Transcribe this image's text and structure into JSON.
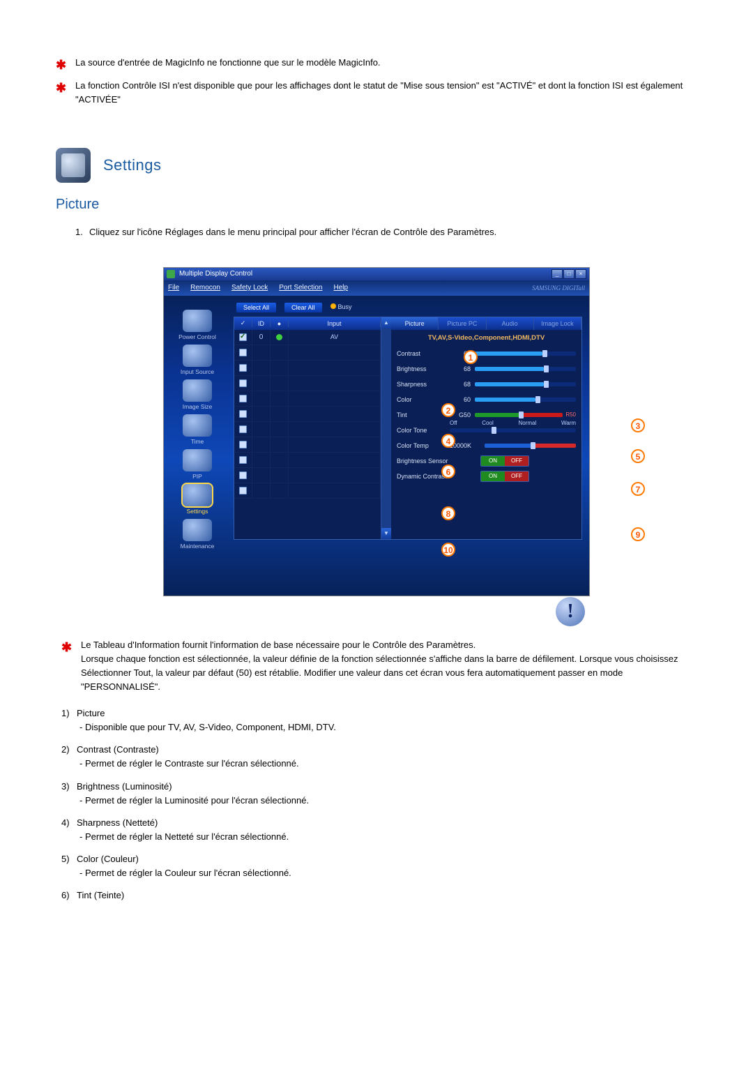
{
  "notes_top": [
    "La source d'entrée de MagicInfo ne fonctionne que sur le modèle MagicInfo.",
    "La fonction Contrôle ISI n'est disponible que pour les affichages dont le statut de \"Mise sous tension\" est \"ACTIVÉ\" et dont la fonction ISI est également \"ACTIVÉE\""
  ],
  "settings_header": "Settings",
  "picture_title": "Picture",
  "instruction": {
    "num": "1.",
    "text": "Cliquez sur l'icône Réglages dans le menu principal pour afficher l'écran de Contrôle des Paramètres."
  },
  "screenshot": {
    "window_title": "Multiple Display Control",
    "menu": [
      "File",
      "Remocon",
      "Safety Lock",
      "Port Selection",
      "Help"
    ],
    "brand": "SAMSUNG DIGITall",
    "sidebar": [
      {
        "label": "Power Control",
        "active": false
      },
      {
        "label": "Input Source",
        "active": false
      },
      {
        "label": "Image Size",
        "active": false
      },
      {
        "label": "Time",
        "active": false
      },
      {
        "label": "PIP",
        "active": false
      },
      {
        "label": "Settings",
        "active": true
      },
      {
        "label": "Maintenance",
        "active": false
      }
    ],
    "toolbar": {
      "select_all": "Select All",
      "clear_all": "Clear All",
      "busy": "Busy"
    },
    "grid": {
      "headers": {
        "c1": "✓",
        "c2": "ID",
        "c3": "●",
        "c4": "Input"
      },
      "rows": [
        {
          "checked": true,
          "id": "0",
          "status": "green",
          "input": "AV"
        },
        {
          "checked": false,
          "id": "",
          "status": "",
          "input": ""
        },
        {
          "checked": false,
          "id": "",
          "status": "",
          "input": ""
        },
        {
          "checked": false,
          "id": "",
          "status": "",
          "input": ""
        },
        {
          "checked": false,
          "id": "",
          "status": "",
          "input": ""
        },
        {
          "checked": false,
          "id": "",
          "status": "",
          "input": ""
        },
        {
          "checked": false,
          "id": "",
          "status": "",
          "input": ""
        },
        {
          "checked": false,
          "id": "",
          "status": "",
          "input": ""
        },
        {
          "checked": false,
          "id": "",
          "status": "",
          "input": ""
        },
        {
          "checked": false,
          "id": "",
          "status": "",
          "input": ""
        },
        {
          "checked": false,
          "id": "",
          "status": "",
          "input": ""
        }
      ]
    },
    "tabs": [
      "Picture",
      "Picture PC",
      "Audio",
      "Image Lock"
    ],
    "active_tab": 0,
    "panel": {
      "subtitle": "TV,AV,S-Video,Component,HDMI,DTV",
      "contrast": {
        "label": "Contrast",
        "value": "67"
      },
      "brightness": {
        "label": "Brightness",
        "value": "68"
      },
      "sharpness": {
        "label": "Sharpness",
        "value": "68"
      },
      "color": {
        "label": "Color",
        "value": "60"
      },
      "tint": {
        "label": "Tint",
        "gvalue": "G50",
        "rvalue": "R50"
      },
      "colortone": {
        "label": "Color Tone",
        "options": [
          "Off",
          "Cool",
          "Normal",
          "Warm"
        ]
      },
      "colortemp": {
        "label": "Color Temp",
        "value": "10000K"
      },
      "brightness_sensor": {
        "label": "Brightness Sensor",
        "on": "ON",
        "off": "OFF"
      },
      "dynamic_contrast": {
        "label": "Dynamic Contrast",
        "on": "ON",
        "off": "OFF"
      }
    },
    "callouts": [
      "1",
      "2",
      "3",
      "4",
      "5",
      "6",
      "7",
      "8",
      "9",
      "10"
    ]
  },
  "after_star": "Le Tableau d'Information fournit l'information de base nécessaire pour le Contrôle des Paramètres.",
  "after_para": "Lorsque chaque fonction est sélectionnée, la valeur définie de la fonction sélectionnée s'affiche dans la barre de défilement. Lorsque vous choisissez Sélectionner Tout, la valeur par défaut (50) est rétablie. Modifier une valeur dans cet écran vous fera automatiquement passer en mode \"PERSONNALISÉ\".",
  "numbered": [
    {
      "n": "1)",
      "title": "Picture",
      "sub": "- Disponible que pour TV, AV, S-Video, Component, HDMI, DTV."
    },
    {
      "n": "2)",
      "title": "Contrast (Contraste)",
      "sub": "- Permet de régler le Contraste sur l'écran sélectionné."
    },
    {
      "n": "3)",
      "title": "Brightness (Luminosité)",
      "sub": "- Permet de régler la Luminosité pour l'écran sélectionné."
    },
    {
      "n": "4)",
      "title": "Sharpness (Netteté)",
      "sub": "- Permet de régler la Netteté sur l'écran sélectionné."
    },
    {
      "n": "5)",
      "title": "Color (Couleur)",
      "sub": "- Permet de régler la Couleur sur l'écran sélectionné."
    },
    {
      "n": "6)",
      "title": "Tint (Teinte)",
      "sub": ""
    }
  ]
}
